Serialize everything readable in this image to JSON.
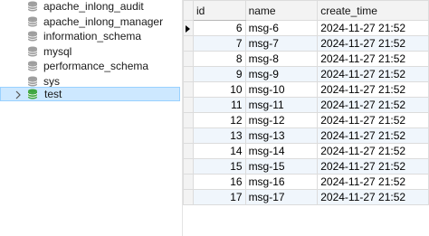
{
  "tree": {
    "items": [
      {
        "label": "apache_inlong_audit",
        "selected": false
      },
      {
        "label": "apache_inlong_manager",
        "selected": false
      },
      {
        "label": "information_schema",
        "selected": false
      },
      {
        "label": "mysql",
        "selected": false
      },
      {
        "label": "performance_schema",
        "selected": false
      },
      {
        "label": "sys",
        "selected": false
      },
      {
        "label": "test",
        "selected": true
      }
    ]
  },
  "grid": {
    "columns": [
      "id",
      "name",
      "create_time"
    ],
    "rows": [
      {
        "id": "6",
        "name": "msg-6",
        "create_time": "2024-11-27 21:52"
      },
      {
        "id": "7",
        "name": "msg-7",
        "create_time": "2024-11-27 21:52"
      },
      {
        "id": "8",
        "name": "msg-8",
        "create_time": "2024-11-27 21:52"
      },
      {
        "id": "9",
        "name": "msg-9",
        "create_time": "2024-11-27 21:52"
      },
      {
        "id": "10",
        "name": "msg-10",
        "create_time": "2024-11-27 21:52"
      },
      {
        "id": "11",
        "name": "msg-11",
        "create_time": "2024-11-27 21:52"
      },
      {
        "id": "12",
        "name": "msg-12",
        "create_time": "2024-11-27 21:52"
      },
      {
        "id": "13",
        "name": "msg-13",
        "create_time": "2024-11-27 21:52"
      },
      {
        "id": "14",
        "name": "msg-14",
        "create_time": "2024-11-27 21:52"
      },
      {
        "id": "15",
        "name": "msg-15",
        "create_time": "2024-11-27 21:52"
      },
      {
        "id": "16",
        "name": "msg-16",
        "create_time": "2024-11-27 21:52"
      },
      {
        "id": "17",
        "name": "msg-17",
        "create_time": "2024-11-27 21:52"
      }
    ]
  },
  "colors": {
    "selection_bg": "#cde8ff",
    "selection_border": "#99d1ff",
    "db_icon": "#9e9e9e",
    "db_icon_selected": "#3fa63f",
    "alt_row": "#f0f6fc"
  },
  "icons": {
    "database": "database-icon",
    "expand": "chevron-right-icon",
    "current_row": "current-row-arrow-icon"
  }
}
